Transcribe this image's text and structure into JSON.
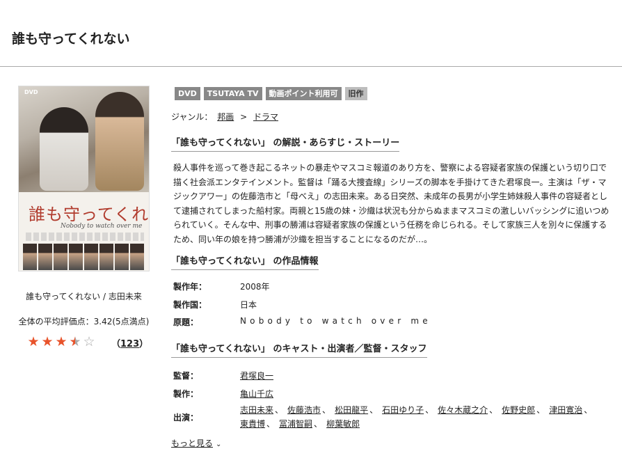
{
  "page": {
    "title": "誰も守ってくれない"
  },
  "cover": {
    "dvd_mark": "DVD",
    "title": "誰も守ってくれない",
    "subtitle": "Nobody to watch over me"
  },
  "caption": "誰も守ってくれない / 志田未来",
  "rating": {
    "average_text": "全体の平均評価点：3.42(5点満点)",
    "value": 3.42,
    "max": 5,
    "count_label": "123",
    "color": "#e8532b"
  },
  "tags": [
    "DVD",
    "TSUTAYA TV",
    "動画ポイント利用可",
    "旧作"
  ],
  "genre": {
    "label": "ジャンル：",
    "items": [
      "邦画",
      "ドラマ"
    ],
    "separator": ">"
  },
  "sections": {
    "story": {
      "title": "「誰も守ってくれない」 の解説・あらすじ・ストーリー",
      "text": "殺人事件を巡って巻き起こるネットの暴走やマスコミ報道のあり方を、警察による容疑者家族の保護という切り口で描く社会派エンタテインメント。監督は「踊る大捜査線」シリーズの脚本を手掛けてきた君塚良一。主演は「ザ・マジックアワー」の佐藤浩市と「母べえ」の志田未来。ある日突然、未成年の長男が小学生姉妹殺人事件の容疑者として逮捕されてしまった船村家。両親と15歳の妹・沙織は状況も分からぬままマスコミの激しいバッシングに追いつめられていく。そんな中、刑事の勝浦は容疑者家族の保護という任務を命じられる。そして家族三人を別々に保護するため、同い年の娘を持つ勝浦が沙織を担当することになるのだが…。"
    },
    "info": {
      "title": "「誰も守ってくれない」 の作品情報",
      "rows": [
        {
          "key": "製作年：",
          "value": "2008年"
        },
        {
          "key": "製作国：",
          "value": "日本"
        },
        {
          "key": "原題：",
          "value": "Nobody to watch over me"
        }
      ]
    },
    "cast": {
      "title": "「誰も守ってくれない」 のキャスト・出演者／監督・スタッフ",
      "director_label": "監督：",
      "director": "君塚良一",
      "producer_label": "製作：",
      "producer": "亀山千広",
      "actors_label": "出演：",
      "actors_line1": [
        "志田未来",
        "佐藤浩市",
        "松田龍平",
        "石田ゆり子",
        "佐々木蔵之介",
        "佐野史郎",
        "津田寛治"
      ],
      "actors_line2": [
        "東貴博",
        "冨浦智嗣",
        "柳葉敏郎"
      ],
      "more_label": "もっと見る"
    }
  }
}
